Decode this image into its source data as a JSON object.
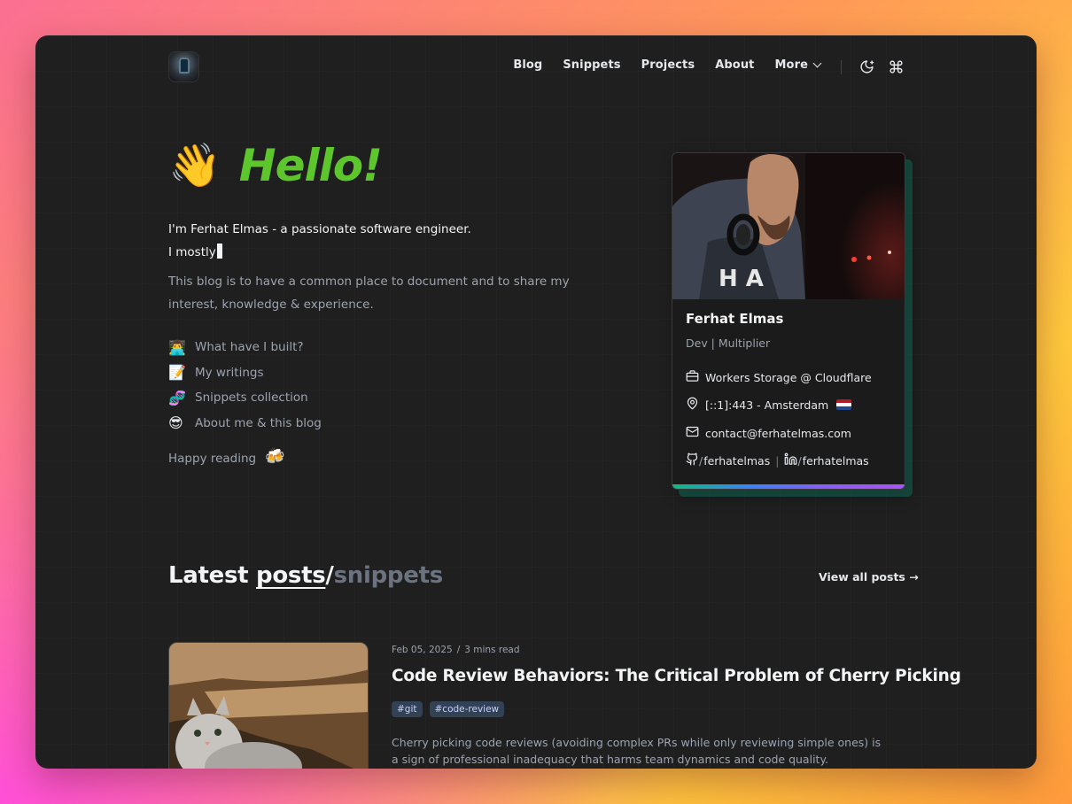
{
  "nav": {
    "links": [
      "Blog",
      "Snippets",
      "Projects",
      "About"
    ],
    "more_label": "More",
    "icons": [
      "logo-avatar",
      "theme-toggle-moon-icon",
      "command-icon"
    ]
  },
  "hero": {
    "wave_emoji": "👋",
    "title": "Hello!",
    "intro_line1": "I'm Ferhat Elmas - a passionate software engineer.",
    "intro_line2": "I mostly",
    "blurb": "This blog is to have a common place to document and to share my interest, knowledge & experience.",
    "links": [
      {
        "emoji": "👨‍💻",
        "label": "What have I built?"
      },
      {
        "emoji": "📝",
        "label": "My writings"
      },
      {
        "emoji": "🧬",
        "label": "Snippets collection"
      },
      {
        "emoji": "😎",
        "label": "About me & this blog"
      }
    ],
    "happy_text": "Happy reading",
    "happy_emoji": "🍻"
  },
  "card": {
    "name": "Ferhat Elmas",
    "role": "Dev | Multiplier",
    "job": "Workers Storage @ Cloudflare",
    "location": "[::1]:443 - Amsterdam",
    "email": "contact@ferhatelmas.com",
    "github": "ferhatelmas",
    "linkedin": "ferhatelmas"
  },
  "latest": {
    "heading_1": "Latest",
    "heading_posts": "posts",
    "heading_slash": "/",
    "heading_snippets": "snippets",
    "view_all": "View all posts →"
  },
  "post": {
    "date": "Feb 05, 2025",
    "separator": "/",
    "read_time": "3 mins read",
    "title": "Code Review Behaviors: The Critical Problem of Cherry Picking",
    "tags": [
      "#git",
      "#code-review"
    ],
    "excerpt": "Cherry picking code reviews (avoiding complex PRs while only reviewing simple ones) is a sign of professional inadequacy that harms team dynamics and code quality."
  },
  "colors": {
    "accent_green": "#5cc62c",
    "page_bg": "#1f1f1f",
    "card_shadow": "#107864"
  }
}
